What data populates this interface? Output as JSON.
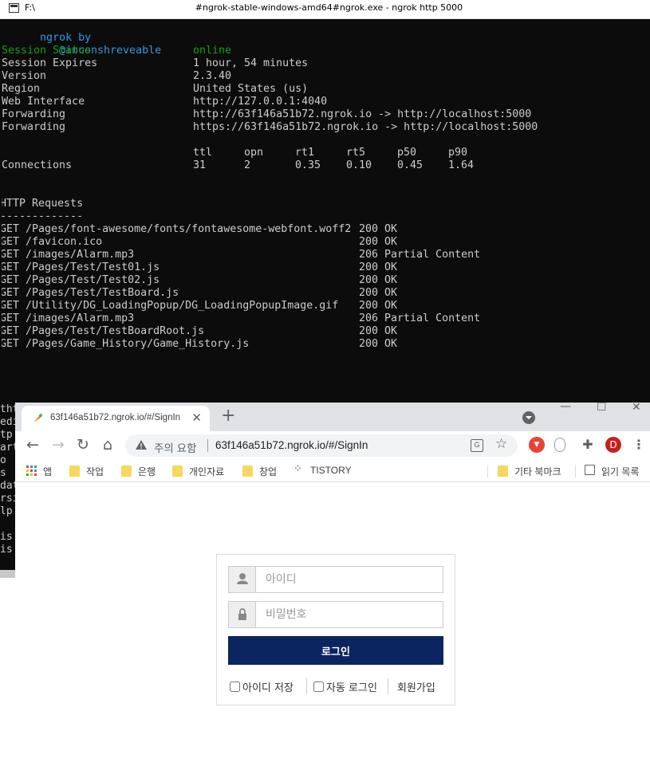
{
  "console": {
    "path": "F:\\",
    "title": "#ngrok-stable-windows-amd64#ngrok.exe - ngrok  http 5000",
    "brand": "ngrok by",
    "author": "@inconshreveable",
    "status": [
      {
        "label": "Session Status",
        "value": "online"
      },
      {
        "label": "Session Expires",
        "value": "1 hour, 54 minutes"
      },
      {
        "label": "Version",
        "value": "2.3.40"
      },
      {
        "label": "Region",
        "value": "United States (us)"
      },
      {
        "label": "Web Interface",
        "value": "http://127.0.0.1:4040"
      },
      {
        "label": "Forwarding",
        "value": "http://63f146a51b72.ngrok.io -> http://localhost:5000"
      },
      {
        "label": "Forwarding",
        "value": "https://63f146a51b72.ngrok.io -> http://localhost:5000"
      }
    ],
    "connections": {
      "label": "Connections",
      "metrics": [
        {
          "name": "ttl",
          "value": "31"
        },
        {
          "name": "opn",
          "value": "2"
        },
        {
          "name": "rt1",
          "value": "0.35"
        },
        {
          "name": "rt5",
          "value": "0.10"
        },
        {
          "name": "p50",
          "value": "0.45"
        },
        {
          "name": "p90",
          "value": "1.64"
        }
      ]
    },
    "requests_title": "HTTP Requests",
    "requests_rule": "-------------",
    "requests": [
      {
        "path": "GET /Pages/font-awesome/fonts/fontawesome-webfont.woff2",
        "status": "200 OK"
      },
      {
        "path": "GET /favicon.ico",
        "status": "200 OK"
      },
      {
        "path": "GET /images/Alarm.mp3",
        "status": "206 Partial Content"
      },
      {
        "path": "GET /Pages/Test/Test01.js",
        "status": "200 OK"
      },
      {
        "path": "GET /Pages/Test/Test02.js",
        "status": "200 OK"
      },
      {
        "path": "GET /Pages/Test/TestBoard.js",
        "status": "200 OK"
      },
      {
        "path": "GET /Utility/DG_LoadingPopup/DG_LoadingPopupImage.gif",
        "status": "200 OK"
      },
      {
        "path": "GET /images/Alarm.mp3",
        "status": "206 Partial Content"
      },
      {
        "path": "GET /Pages/Test/TestBoardRoot.js",
        "status": "200 OK"
      },
      {
        "path": "GET /Pages/Game_History/Game_History.js",
        "status": "200 OK"
      }
    ]
  },
  "background_window": {
    "fragments": [
      "tht",
      "edi",
      "tp",
      "art",
      "o",
      "s",
      "dat",
      "rsi",
      "lp",
      "",
      "is",
      "is"
    ]
  },
  "browser": {
    "tab_title": "63f146a51b72.ngrok.io/#/SignIn",
    "security_label": "주의 요함",
    "url": "63f146a51b72.ngrok.io/#/SignIn",
    "profile_initial": "D",
    "bookmarks": [
      {
        "label": "앱",
        "icon": "apps-grid-icon"
      },
      {
        "label": "작업",
        "icon": "folder-icon"
      },
      {
        "label": "은행",
        "icon": "folder-icon"
      },
      {
        "label": "개인자료",
        "icon": "folder-icon"
      },
      {
        "label": "창업",
        "icon": "folder-icon"
      },
      {
        "label": "TISTORY",
        "icon": "tistory-icon"
      }
    ],
    "other_bookmarks": "기타 북마크",
    "reading_list": "읽기 목록"
  },
  "login": {
    "id_placeholder": "아이디",
    "password_placeholder": "비밀번호",
    "login_button": "로그인",
    "save_id": "아이디 저장",
    "auto_login": "자동 로그인",
    "signup": "회원가입",
    "button_color": "#0b2560"
  },
  "colors": {
    "console_bg": "#0c0c0c",
    "console_text": "#cccccc",
    "online_green": "#13a10e",
    "author_cyan": "#3a96dd",
    "tab_strip": "#dee1e6",
    "profile_red": "#c5221f"
  }
}
